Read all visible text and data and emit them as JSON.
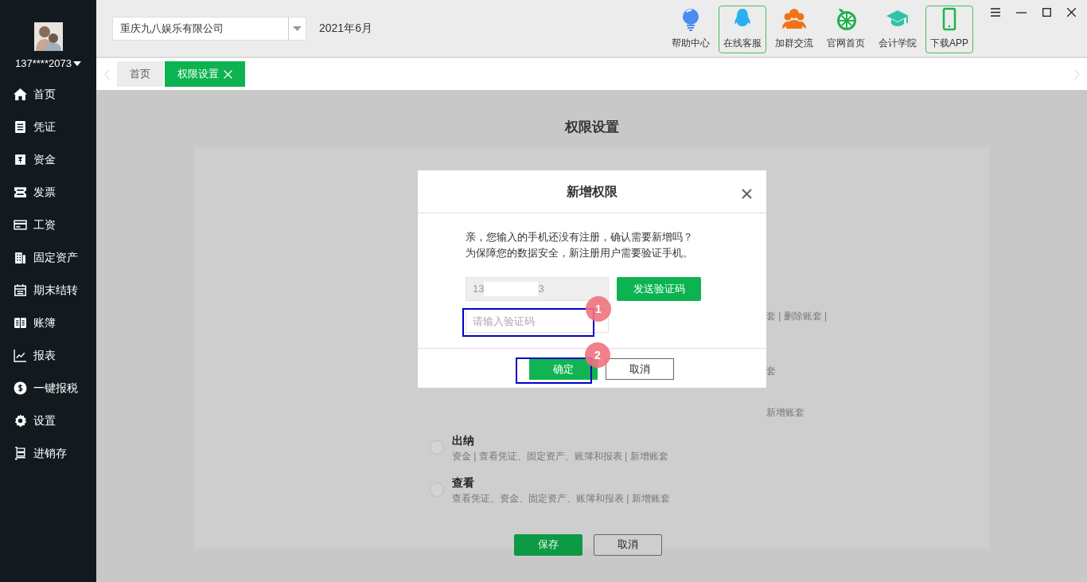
{
  "sidebar": {
    "user": "137****2073",
    "items": [
      {
        "label": "首页"
      },
      {
        "label": "凭证"
      },
      {
        "label": "资金"
      },
      {
        "label": "发票"
      },
      {
        "label": "工资"
      },
      {
        "label": "固定资产"
      },
      {
        "label": "期末结转"
      },
      {
        "label": "账簿"
      },
      {
        "label": "报表"
      },
      {
        "label": "一键报税"
      },
      {
        "label": "设置"
      },
      {
        "label": "进销存"
      }
    ]
  },
  "topbar": {
    "company": "重庆九八娱乐有限公司",
    "period": "2021年6月",
    "tools": [
      {
        "label": "帮助中心",
        "outlined": false
      },
      {
        "label": "在线客服",
        "outlined": true
      },
      {
        "label": "加群交流",
        "outlined": false
      },
      {
        "label": "官网首页",
        "outlined": false
      },
      {
        "label": "会计学院",
        "outlined": false
      },
      {
        "label": "下载APP",
        "outlined": true
      }
    ]
  },
  "tabs": [
    {
      "label": "首页",
      "selected": false,
      "closable": false
    },
    {
      "label": "权限设置",
      "selected": true,
      "closable": true
    }
  ],
  "page": {
    "title": "权限设置",
    "hidden_row_fragments": [
      "套 | 删除账套 |",
      "套",
      "新增账套"
    ],
    "roles": [
      {
        "name": "出纳",
        "description": "资金 | 查看凭证、固定资产、账簿和报表 | 新增账套",
        "selected": false
      },
      {
        "name": "查看",
        "description": "查看凭证、资金、固定资产、账簿和报表 | 新增账套",
        "selected": false
      }
    ],
    "buttons": [
      "保存",
      "取消"
    ]
  },
  "dialog": {
    "title": "新增权限",
    "message": [
      "亲，您输入的手机还没有注册，确认需要新增吗？",
      "为保障您的数据安全，新注册用户需要验证手机。"
    ],
    "phone": {
      "start": "13",
      "end": "3"
    },
    "send_button": "发送验证码",
    "code_placeholder": "请输入验证码",
    "confirm": "确定",
    "cancel": "取消",
    "annotations": [
      {
        "number": "1"
      },
      {
        "number": "2"
      }
    ]
  }
}
